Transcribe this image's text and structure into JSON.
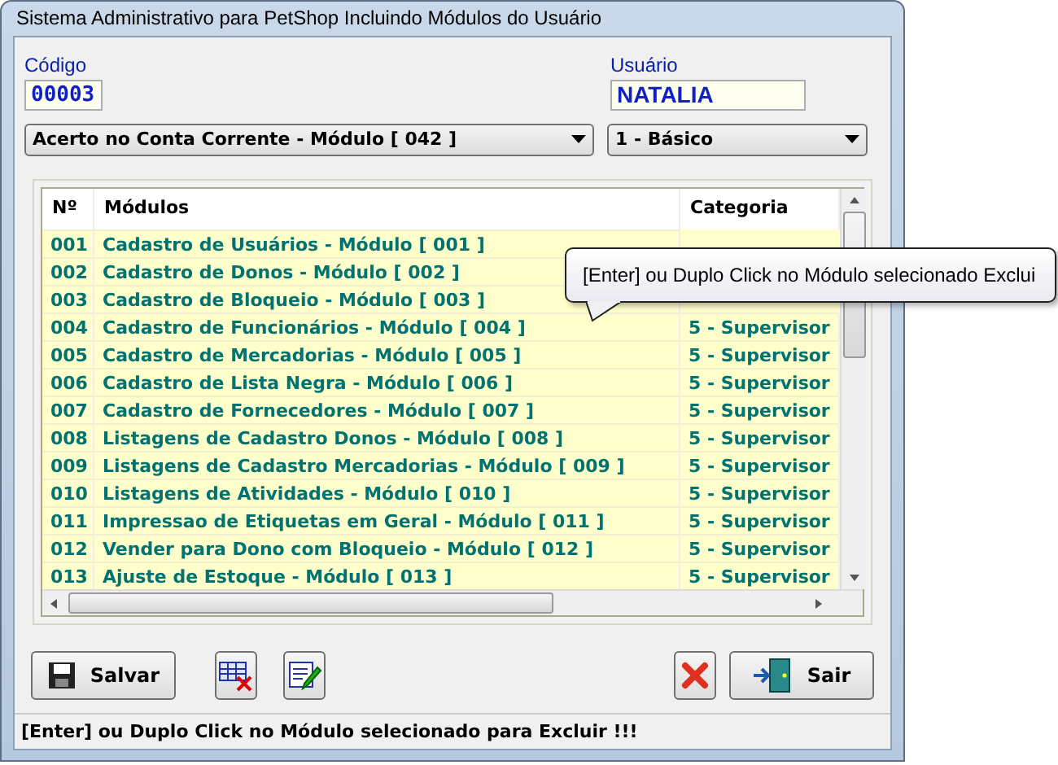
{
  "window": {
    "title": "Sistema Administrativo para PetShop Incluindo Módulos do Usuário"
  },
  "codigo": {
    "label": "Código",
    "value": "00003"
  },
  "usuario": {
    "label": "Usuário",
    "value": "NATALIA"
  },
  "module_select": {
    "value": "Acerto no Conta Corrente - Módulo [ 042 ]"
  },
  "level_select": {
    "value": "1 - Básico"
  },
  "table": {
    "columns": [
      "Nº",
      "Módulos",
      "Categoria"
    ],
    "rows": [
      {
        "number": "001",
        "module": "Cadastro de Usuários - Módulo [ 001 ]"
      },
      {
        "number": "002",
        "module": "Cadastro de Donos - Módulo [ 002 ]"
      },
      {
        "number": "003",
        "module": "Cadastro de Bloqueio - Módulo [ 003 ]"
      },
      {
        "number": "004",
        "module": "Cadastro de Funcionários - Módulo [ 004 ]",
        "category": "5 - Supervisor"
      },
      {
        "number": "005",
        "module": "Cadastro de Mercadorias - Módulo [ 005 ]",
        "category": "5 - Supervisor"
      },
      {
        "number": "006",
        "module": "Cadastro de Lista Negra - Módulo [ 006 ]",
        "category": "5 - Supervisor"
      },
      {
        "number": "007",
        "module": "Cadastro de Fornecedores - Módulo [ 007 ]",
        "category": "5 - Supervisor"
      },
      {
        "number": "008",
        "module": "Listagens de Cadastro Donos - Módulo [ 008 ]",
        "category": "5 - Supervisor"
      },
      {
        "number": "009",
        "module": "Listagens de Cadastro Mercadorias - Módulo [ 009 ]",
        "category": "5 - Supervisor"
      },
      {
        "number": "010",
        "module": "Listagens de Atividades - Módulo [ 010 ]",
        "category": "5 - Supervisor"
      },
      {
        "number": "011",
        "module": "Impressao de Etiquetas em Geral - Módulo [ 011 ]",
        "category": "5 - Supervisor"
      },
      {
        "number": "012",
        "module": "Vender para Dono com Bloqueio - Módulo [ 012 ]",
        "category": "5 - Supervisor"
      },
      {
        "number": "013",
        "module": "Ajuste de Estoque - Módulo [ 013 ]",
        "category": "5 - Supervisor"
      }
    ]
  },
  "tooltip": "[Enter] ou Duplo Click no Módulo selecionado Exclui",
  "buttons": [
    {
      "kind": "save",
      "label": "Salvar"
    },
    {
      "kind": "grid-delete"
    },
    {
      "kind": "edit"
    },
    {
      "kind": "cancel"
    },
    {
      "kind": "exit",
      "label": "Sair"
    }
  ],
  "status_bar": "[Enter] ou Duplo Click no Módulo selecionado para Excluir !!!"
}
